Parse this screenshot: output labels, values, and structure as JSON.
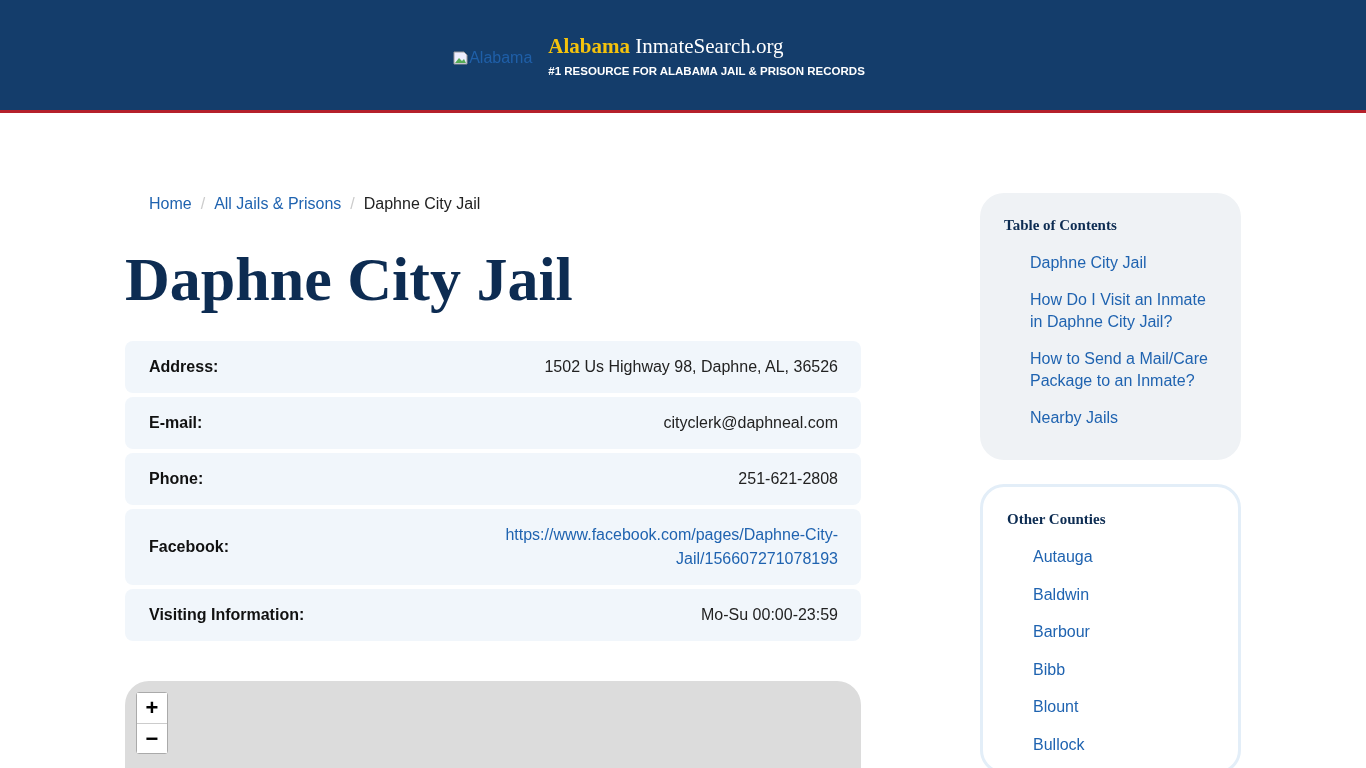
{
  "header": {
    "logo_alt": "Alabama",
    "site_name_highlight": "Alabama",
    "site_name_rest": "InmateSearch.org",
    "tagline": "#1 RESOURCE FOR ALABAMA JAIL & PRISON RECORDS"
  },
  "breadcrumb": [
    {
      "label": "Home",
      "kind": "link"
    },
    {
      "separator": "/",
      "label": "All Jails & Prisons",
      "kind": "link"
    },
    {
      "separator": "/",
      "label": "Daphne City Jail",
      "kind": "current"
    }
  ],
  "title": "Daphne City Jail",
  "details": [
    {
      "label": "Address:",
      "value": "1502 Us Highway 98, Daphne, AL, 36526",
      "kind": "text"
    },
    {
      "label": "E-mail:",
      "value": "cityclerk@daphneal.com",
      "kind": "text"
    },
    {
      "label": "Phone:",
      "value": "251-621-2808",
      "kind": "text"
    },
    {
      "label": "Facebook:",
      "value": "https://www.facebook.com/pages/Daphne-City-Jail/156607271078193",
      "kind": "link"
    },
    {
      "label": "Visiting Information:",
      "value": "Mo-Su 00:00-23:59",
      "kind": "text"
    }
  ],
  "map": {
    "zoom_in": "+",
    "zoom_out": "−"
  },
  "toc": {
    "title": "Table of Contents",
    "items": [
      "Daphne City Jail",
      "How Do I Visit an Inmate in Daphne City Jail?",
      "How to Send a Mail/Care Package to an Inmate?",
      "Nearby Jails"
    ]
  },
  "counties": {
    "title": "Other Counties",
    "items": [
      "Autauga",
      "Baldwin",
      "Barbour",
      "Bibb",
      "Blount",
      "Bullock"
    ]
  }
}
